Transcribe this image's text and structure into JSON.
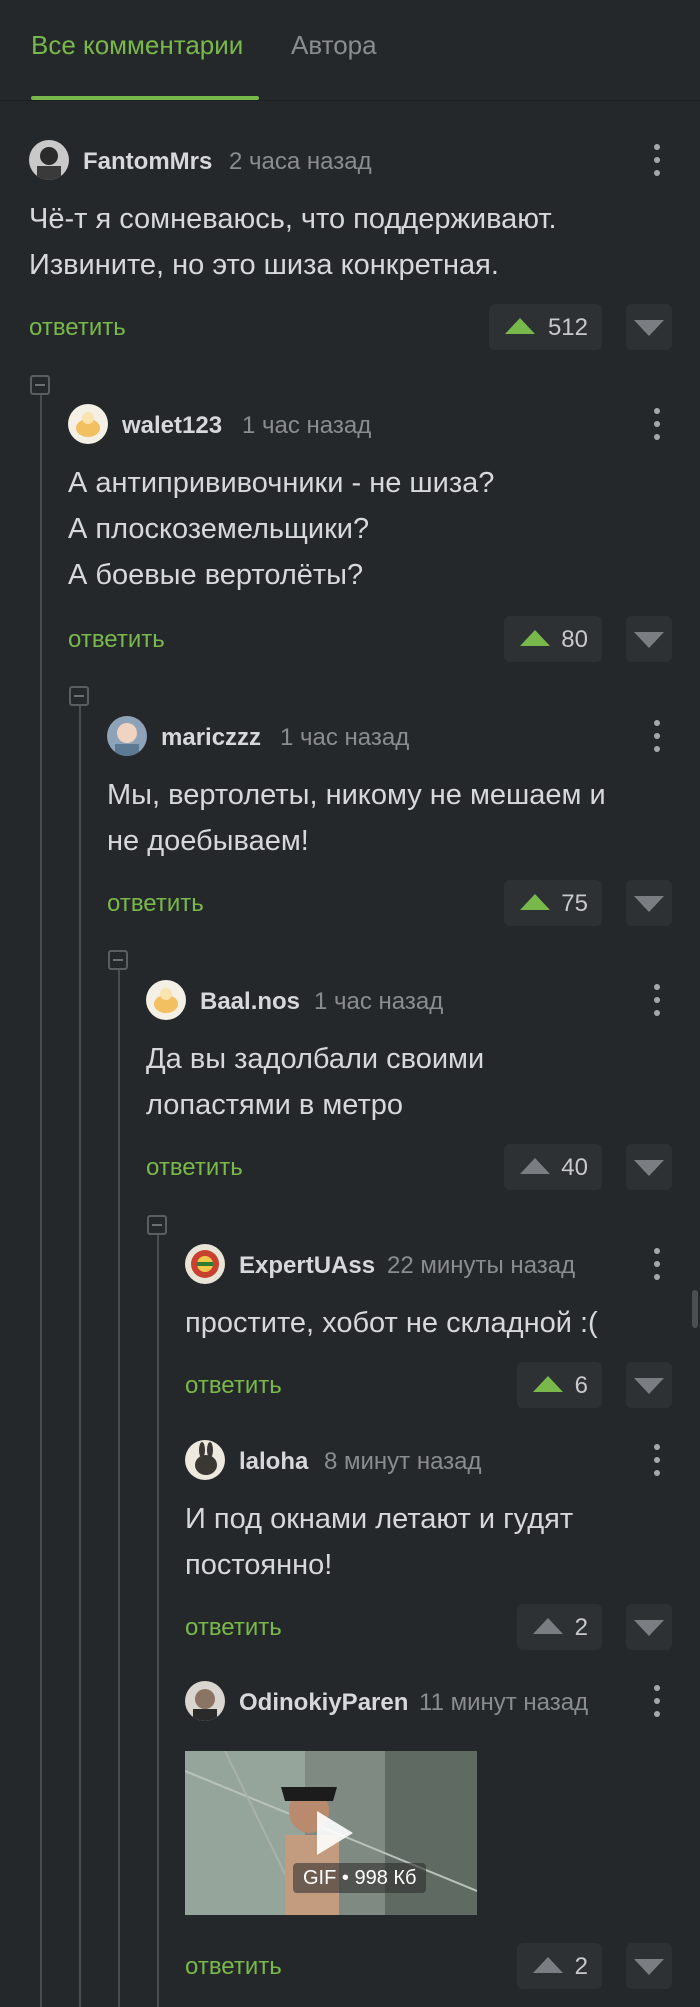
{
  "tabs": {
    "all": "Все комментарии",
    "author": "Автора"
  },
  "comments": [
    {
      "author": "FantomMrs",
      "time": "2 часа назад",
      "lines": [
        "Чё-т я сомневаюсь, что поддерживают.",
        "Извините, но это шиза конкретная."
      ],
      "reply": "ответить",
      "votes": "512",
      "upvoted": true
    },
    {
      "author": "walet123",
      "time": "1 час назад",
      "lines": [
        "А антипрививочники - не шиза?",
        "А плоскоземельщики?",
        "А боевые вертолёты?"
      ],
      "reply": "ответить",
      "votes": "80",
      "upvoted": true
    },
    {
      "author": "mariczzz",
      "time": "1 час назад",
      "lines": [
        "Мы, вертолеты, никому не мешаем и",
        "не доебываем!"
      ],
      "reply": "ответить",
      "votes": "75",
      "upvoted": true
    },
    {
      "author": "Baal.nos",
      "time": "1 час назад",
      "lines": [
        "Да вы задолбали своими",
        "лопастями в метро"
      ],
      "reply": "ответить",
      "votes": "40",
      "upvoted": false
    },
    {
      "author": "ExpertUAss",
      "time": "22 минуты назад",
      "lines": [
        "простите, хобот не складной :("
      ],
      "reply": "ответить",
      "votes": "6",
      "upvoted": true
    },
    {
      "author": "laloha",
      "time": "8 минут назад",
      "lines": [
        "И под окнами летают и гудят",
        "постоянно!"
      ],
      "reply": "ответить",
      "votes": "2",
      "upvoted": false
    },
    {
      "author": "OdinokiyParen",
      "time": "11 минут назад",
      "gif_label": "GIF • 998 Кб",
      "reply": "ответить",
      "votes": "2",
      "upvoted": false
    }
  ],
  "colors": {
    "background": "#25282b",
    "accent": "#79b84a",
    "muted": "#8a8d90"
  }
}
